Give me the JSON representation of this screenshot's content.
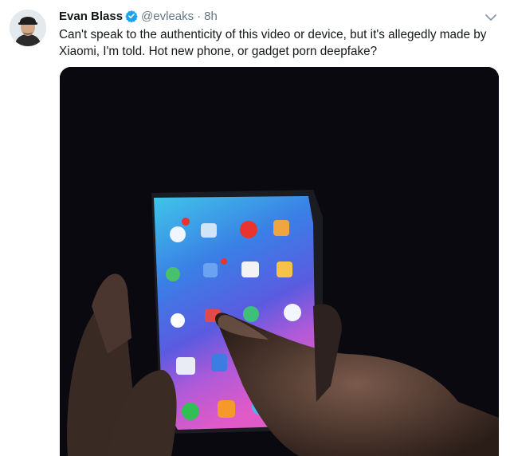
{
  "author": {
    "name": "Evan Blass",
    "handle": "@evleaks",
    "separator": "·",
    "time": "8h"
  },
  "tweet": {
    "lines": [
      "Can't speak to the authenticity of this video or device, but it's allegedly made by",
      "Xiaomi, I'm told. Hot new phone, or gadget porn deepfake?"
    ]
  },
  "icons": {
    "verified": "verified-badge-icon",
    "menu": "chevron-down-icon"
  },
  "colors": {
    "verified": "#1da1f2",
    "secondary_text": "#657786",
    "primary_text": "#14171a"
  }
}
